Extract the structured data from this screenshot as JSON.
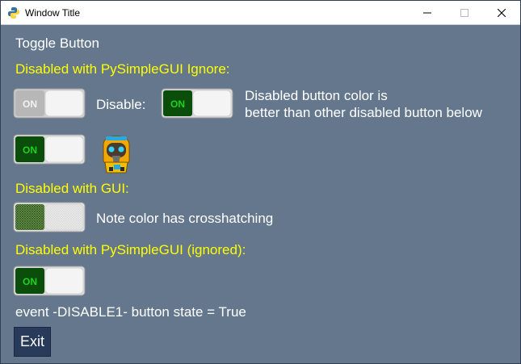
{
  "window": {
    "title": "Window Title",
    "minimize_glyph": "—",
    "maximize_glyph": "☐",
    "close_glyph": "✕"
  },
  "colors": {
    "background": "#64778d",
    "heading": "#ffffff",
    "section_label": "#ffff00",
    "toggle_on_bg": "#0b4d0b",
    "toggle_on_text": "#1fd21f",
    "toggle_disabled_text": "#f2f2f2",
    "exit_button_bg": "#283b5b"
  },
  "labels": {
    "heading": "Toggle Button",
    "section1": "Disabled with PySimpleGUI Ignore:",
    "disable_label": "Disable:",
    "note_line1": "Disabled button color is",
    "note_line2": "better than other disabled button below",
    "section2": "Disabled with GUI:",
    "crosshatch_note": "Note color has crosshatching",
    "section3": "Disabled with PySimpleGUI (ignored):",
    "event_status": "event -DISABLE1- button state = True"
  },
  "toggles": {
    "ignored_disabled": {
      "text": "ON",
      "state": "on",
      "disabled": true
    },
    "disable_control": {
      "text": "ON",
      "state": "on",
      "disabled": false
    },
    "enabled": {
      "text": "ON",
      "state": "on",
      "disabled": false
    },
    "gui_disabled": {
      "text": "",
      "state": "on",
      "disabled": true,
      "crosshatched": true
    },
    "ignored_enabled": {
      "text": "ON",
      "state": "on",
      "disabled": false
    }
  },
  "buttons": {
    "exit": "Exit"
  },
  "icons": {
    "app": "python-logo-icon",
    "mascot": "robot-mascot-icon"
  }
}
